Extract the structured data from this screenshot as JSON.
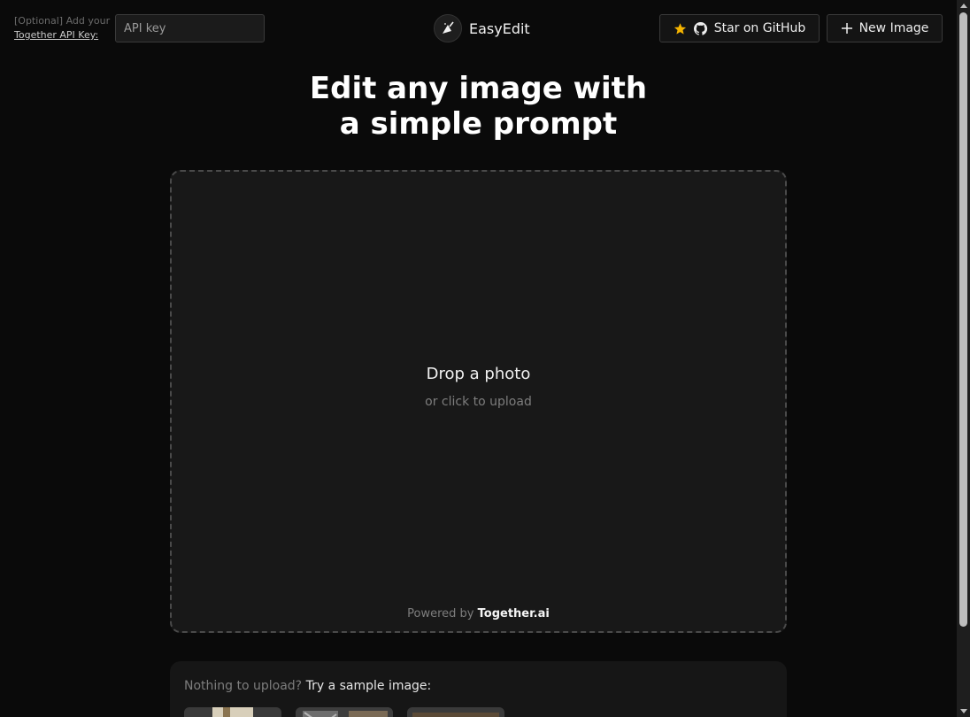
{
  "header": {
    "apikey": {
      "label_prefix": "[Optional] Add your",
      "label_link": "Together API Key:",
      "placeholder": "API key"
    },
    "brand": {
      "name": "EasyEdit",
      "logo_icon": "logo-icon"
    },
    "buttons": {
      "star": {
        "label": "Star on GitHub",
        "icon": "star-icon",
        "icon2": "github-icon"
      },
      "new_image": {
        "label": "New Image",
        "icon": "plus-icon"
      }
    }
  },
  "hero": {
    "line1": "Edit any image with",
    "line2": "a simple prompt"
  },
  "dropzone": {
    "title": "Drop a photo",
    "subtitle": "or click to upload",
    "powered_prefix": "Powered by",
    "powered_brand": "Together.ai"
  },
  "samples": {
    "prefix": "Nothing to upload?",
    "strong": "Try a sample image:"
  },
  "colors": {
    "background": "#0a0a0a",
    "surface": "#181818",
    "star": "#f5b400",
    "text": "#ffffff",
    "muted": "#7d7d7d"
  }
}
